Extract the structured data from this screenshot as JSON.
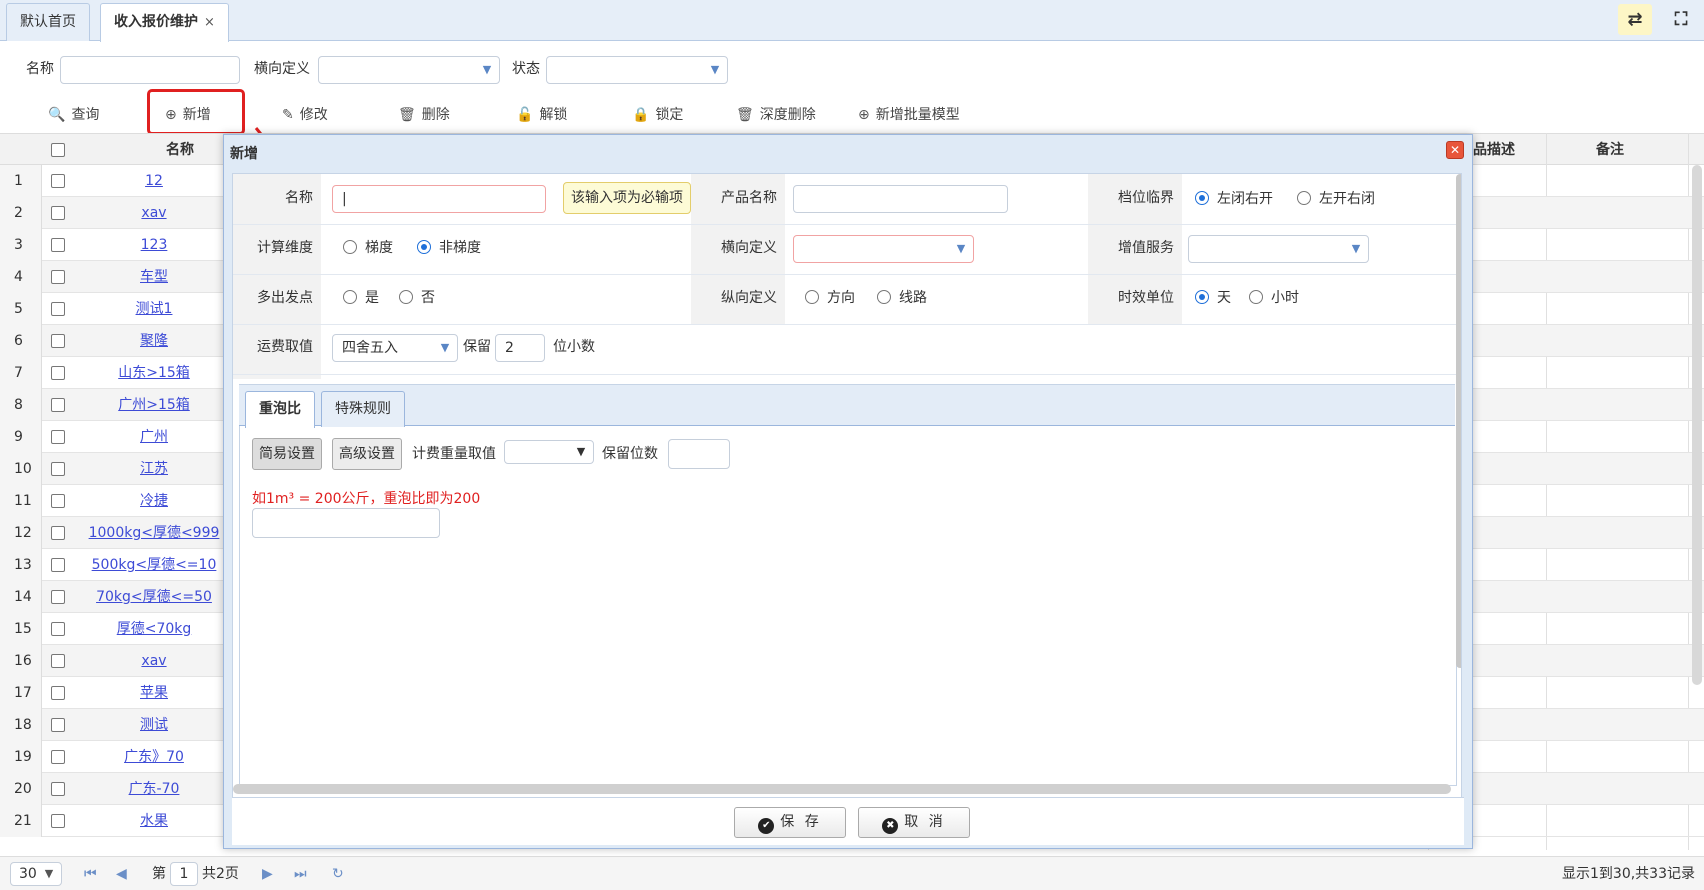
{
  "tabs": [
    {
      "label": "默认首页"
    },
    {
      "label": "收入报价维护",
      "close": "×"
    }
  ],
  "topbar_icons": {
    "refresh": "⇄",
    "fullscreen": "⛶"
  },
  "search": {
    "name_label": "名称",
    "name_value": "",
    "horizontal_label": "横向定义",
    "status_label": "状态"
  },
  "toolbar": [
    {
      "icon": "search-icon",
      "glyph": "🔍",
      "label": "查询"
    },
    {
      "icon": "add-icon",
      "glyph": "⊕",
      "label": "新增"
    },
    {
      "icon": "edit-icon",
      "glyph": "✎",
      "label": "修改"
    },
    {
      "icon": "trash-icon",
      "glyph": "🗑",
      "label": "删除"
    },
    {
      "icon": "unlock-icon",
      "glyph": "🔓",
      "label": "解锁"
    },
    {
      "icon": "lock-icon",
      "glyph": "🔒",
      "label": "锁定"
    },
    {
      "icon": "trash-icon",
      "glyph": "🗑",
      "label": "深度删除"
    },
    {
      "icon": "add-icon",
      "glyph": "⊕",
      "label": "新增批量模型"
    }
  ],
  "grid": {
    "headers": {
      "name": "名称",
      "desc": "品描述",
      "remark": "备注"
    },
    "rows": [
      {
        "n": "1",
        "name": "12"
      },
      {
        "n": "2",
        "name": "xav"
      },
      {
        "n": "3",
        "name": "123"
      },
      {
        "n": "4",
        "name": "车型"
      },
      {
        "n": "5",
        "name": "测试1"
      },
      {
        "n": "6",
        "name": "聚隆"
      },
      {
        "n": "7",
        "name": "山东>15箱"
      },
      {
        "n": "8",
        "name": "广州>15箱"
      },
      {
        "n": "9",
        "name": "广州"
      },
      {
        "n": "10",
        "name": "江苏"
      },
      {
        "n": "11",
        "name": "冷捷"
      },
      {
        "n": "12",
        "name": "1000kg<厚德<999"
      },
      {
        "n": "13",
        "name": "500kg<厚德<=10"
      },
      {
        "n": "14",
        "name": "70kg<厚德<=50"
      },
      {
        "n": "15",
        "name": "厚德<70kg"
      },
      {
        "n": "16",
        "name": "xav"
      },
      {
        "n": "17",
        "name": "苹果"
      },
      {
        "n": "18",
        "name": "测试"
      },
      {
        "n": "19",
        "name": "广东》70"
      },
      {
        "n": "20",
        "name": "广东-70"
      },
      {
        "n": "21",
        "name": "水果"
      }
    ]
  },
  "pager": {
    "page_size": "30",
    "page_prefix": "第",
    "page_value": "1",
    "total_pages": "共2页",
    "summary": "显示1到30,共33记录"
  },
  "dialog": {
    "title": "新增",
    "close": "✕",
    "fields": {
      "name_label": "名称",
      "name_value": "",
      "required_tip": "该输入项为必输项",
      "product_label": "产品名称",
      "product_value": "",
      "boundary_label": "档位临界",
      "boundary_opt1": "左闭右开",
      "boundary_opt2": "左开右闭",
      "calc_label": "计算维度",
      "calc_opt1": "梯度",
      "calc_opt2": "非梯度",
      "horizontal_label": "横向定义",
      "vas_label": "增值服务",
      "multi_label": "多出发点",
      "multi_opt1": "是",
      "multi_opt2": "否",
      "vertical_label": "纵向定义",
      "vertical_opt1": "方向",
      "vertical_opt2": "线路",
      "time_label": "时效单位",
      "time_opt1": "天",
      "time_opt2": "小时",
      "freight_label": "运费取值",
      "freight_value": "四舍五入",
      "keep_label": "保留",
      "keep_value": "2",
      "decimal_label": "位小数"
    },
    "subtabs": [
      "重泡比",
      "特殊规则"
    ],
    "ratio": {
      "simple_btn": "简易设置",
      "advanced_btn": "高级设置",
      "weight_label": "计费重量取值",
      "digits_label": "保留位数",
      "hint": "如1m³ = 200公斤，重泡比即为200",
      "ratio_value": ""
    },
    "save_btn": "保 存",
    "cancel_btn": "取 消"
  },
  "colors": {
    "accent": "#1e6fd9",
    "highlight": "#e02020",
    "link": "#3d4bd6"
  }
}
